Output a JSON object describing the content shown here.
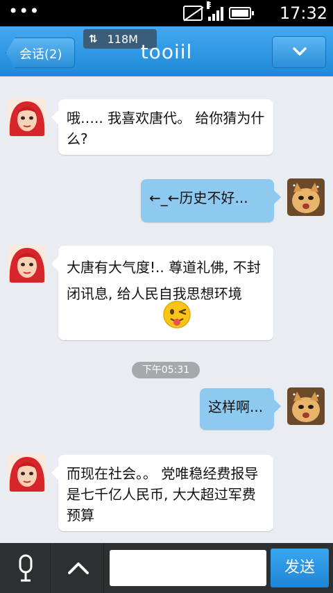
{
  "status_bar": {
    "dots": "•••",
    "time": "17:32"
  },
  "title_bar": {
    "back_label": "会话(2)",
    "speed_label": "118M",
    "title": "tooiil"
  },
  "messages": [
    {
      "side": "left",
      "text": "哦….. 我喜欢唐代。 给你猜为什么?"
    },
    {
      "side": "right",
      "text": "←_←历史不好..."
    },
    {
      "side": "left",
      "text": "大唐有大气度!.. 尊道礼佛, 不封闭讯息, 给人民自我思想环境"
    },
    {
      "side": "right",
      "text": "这样啊..."
    },
    {
      "side": "left",
      "text": "而现在社会。。 党唯稳经费报导是七千亿人民币, 大大超过军费预算"
    }
  ],
  "time_divider": "下午05:31",
  "bottom_bar": {
    "input_placeholder": "",
    "send_label": "发送"
  },
  "colors": {
    "title_bar": "#2a8fd9",
    "right_bubble": "#8ec9f0",
    "background": "#e9edf1",
    "send_button": "#2a8fd9"
  },
  "icons": {
    "back": "chevron-left-icon",
    "menu": "chevron-down-icon",
    "emoji": "wink-tongue-emoji-icon",
    "voice": "microphone-icon",
    "more": "chevron-up-icon"
  }
}
